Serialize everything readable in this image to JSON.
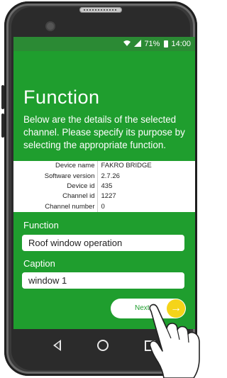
{
  "status_bar": {
    "battery": "71%",
    "time": "14:00"
  },
  "page": {
    "title": "Function",
    "description": "Below are the details of the selected channel. Please specify its purpose by selecting the appropriate function."
  },
  "device_info": [
    {
      "label": "Device name",
      "value": "FAKRO BRIDGE"
    },
    {
      "label": "Software version",
      "value": "2.7.26"
    },
    {
      "label": "Device id",
      "value": "435"
    },
    {
      "label": "Channel id",
      "value": "1227"
    },
    {
      "label": "Channel number",
      "value": "0"
    }
  ],
  "form": {
    "function_label": "Function",
    "function_value": "Roof window operation",
    "caption_label": "Caption",
    "caption_value": "window 1"
  },
  "actions": {
    "next_label": "Next"
  },
  "colors": {
    "screen_green": "#1f9e2e",
    "accent_yellow": "#f5d419"
  },
  "icons": {
    "wifi": "wifi-icon",
    "signal": "signal-icon",
    "battery": "battery-icon",
    "next_arrow": "arrow-right-icon",
    "nav_back": "back-icon",
    "nav_home": "home-icon",
    "nav_recent": "recent-apps-icon"
  }
}
